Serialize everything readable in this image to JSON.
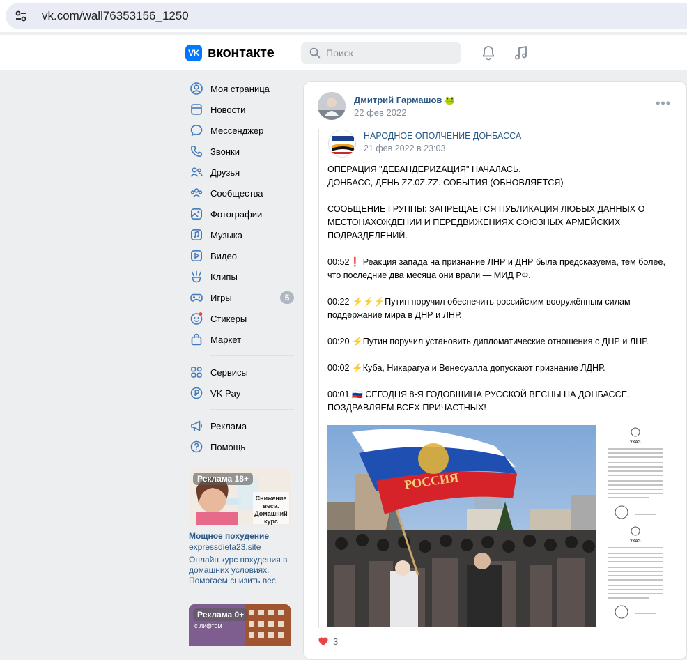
{
  "browser": {
    "url": "vk.com/wall76353156_1250"
  },
  "header": {
    "logo_mark": "VK",
    "logo_text": "вконтакте",
    "search_placeholder": "Поиск",
    "accent": "#0077ff"
  },
  "sidebar": {
    "items": [
      {
        "label": "Моя страница",
        "icon": "user-circle-icon"
      },
      {
        "label": "Новости",
        "icon": "newspaper-icon"
      },
      {
        "label": "Мессенджер",
        "icon": "chat-bubble-icon"
      },
      {
        "label": "Звонки",
        "icon": "phone-icon"
      },
      {
        "label": "Друзья",
        "icon": "friends-icon"
      },
      {
        "label": "Сообщества",
        "icon": "communities-icon"
      },
      {
        "label": "Фотографии",
        "icon": "photo-icon"
      },
      {
        "label": "Музыка",
        "icon": "music-icon"
      },
      {
        "label": "Видео",
        "icon": "video-icon"
      },
      {
        "label": "Клипы",
        "icon": "clips-icon"
      },
      {
        "label": "Игры",
        "icon": "gamepad-icon",
        "badge": "5"
      },
      {
        "label": "Стикеры",
        "icon": "sticker-icon"
      },
      {
        "label": "Маркет",
        "icon": "bag-icon"
      }
    ],
    "items2": [
      {
        "label": "Сервисы",
        "icon": "services-icon"
      },
      {
        "label": "VK Pay",
        "icon": "vkpay-icon"
      }
    ],
    "items3": [
      {
        "label": "Реклама",
        "icon": "megaphone-icon"
      },
      {
        "label": "Помощь",
        "icon": "help-icon"
      }
    ],
    "ads": [
      {
        "label": "Реклама 18+",
        "image_text": "Снижение веса. Домашний курс",
        "title": "Мощное похудение",
        "domain": "expressdieta23.site",
        "description": "Онлайн курс похудения в домашних условиях. Помогаем снизить вес."
      },
      {
        "label": "Реклама 0+",
        "image_text": "с лифтом"
      }
    ]
  },
  "post": {
    "author": "Дмитрий Гармашов",
    "author_badge": "🐸",
    "date": "22 фев 2022",
    "more": "•••",
    "repost": {
      "name": "НАРОДНОЕ ОПОЛЧЕНИЕ ДОНБАССА",
      "date": "21 фев 2022 в 23:03"
    },
    "text": {
      "l1": "ОПЕРАЦИЯ \"ДЕБАНДЕРИZАЦИЯ\" НАЧАЛАСЬ.",
      "l2": "ДОНБАСС, ДЕНЬ ZZ.0Z.ZZ. СОБЫТИЯ (ОБНОВЛЯЕТСЯ)",
      "p2": "СООБЩЕНИЕ ГРУППЫ: ЗАПРЕЩАЕТСЯ ПУБЛИКАЦИЯ ЛЮБЫХ ДАННЫХ О МЕСТОНАХОЖДЕНИИ И ПЕРЕДВИЖЕНИЯХ СОЮЗНЫХ АРМЕЙСКИХ ПОДРАЗДЕЛЕНИЙ.",
      "e1_time": "00:52",
      "e1_emoji": "❗",
      "e1_text": "Реакция запада на признание ЛНР и ДНР была предсказуема, тем более, что последние два месяца они врали — МИД РФ.",
      "e2_time": "00:22",
      "e2_emoji": "⚡⚡⚡",
      "e2_text": "Путин поручил обеспечить российским вооружённым силам поддержание мира в ДНР и ЛНР.",
      "e3_time": "00:20",
      "e3_emoji": "⚡",
      "e3_text": "Путин поручил установить дипломатические отношения с ДНР и ЛНР.",
      "e4_time": "00:02",
      "e4_emoji": "⚡",
      "e4_text": "Куба, Никарагуа и Венесуэлла допускают признание ЛДНР.",
      "e5_time": "00:01",
      "e5_emoji": "🇷🇺",
      "e5_text": "СЕГОДНЯ 8-Я ГОДОВЩИНА РУССКОЙ ВЕСНЫ НА ДОНБАССЕ. ПОЗДРАВЛЯЕМ ВСЕХ ПРИЧАСТНЫХ!"
    },
    "photo_flag_text": "РОССИЯ",
    "doc_heading": "УКАЗ",
    "likes": "3",
    "like_color": "#e64646"
  }
}
